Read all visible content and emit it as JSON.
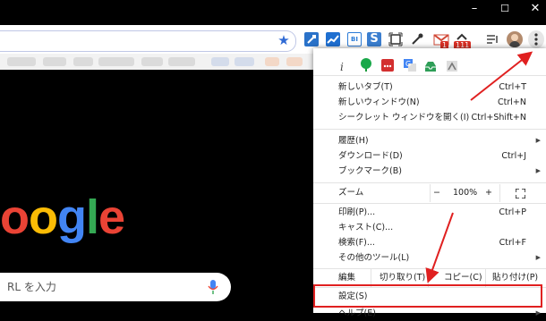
{
  "window": {
    "minimize": "–",
    "maximize": "☐",
    "close": "✕"
  },
  "toolbar": {
    "badge_mail": "1",
    "badge_cal": "111",
    "extensions": [
      "link-ext",
      "analytics-ext",
      "bi-ext",
      "s-ext",
      "capture-ext",
      "eyedropper-ext",
      "gmail-ext",
      "calendar-ext"
    ]
  },
  "logo_letters": [
    {
      "ch": "o",
      "color": "#ea4335"
    },
    {
      "ch": "o",
      "color": "#fbbc05"
    },
    {
      "ch": "g",
      "color": "#4285f4"
    },
    {
      "ch": "l",
      "color": "#34a853"
    },
    {
      "ch": "e",
      "color": "#ea4335"
    }
  ],
  "search": {
    "placeholder": "RL を入力"
  },
  "menu": {
    "new_tab": {
      "label": "新しいタブ(T)",
      "shortcut": "Ctrl+T"
    },
    "new_window": {
      "label": "新しいウィンドウ(N)",
      "shortcut": "Ctrl+N"
    },
    "incognito": {
      "label": "シークレット ウィンドウを開く(I)",
      "shortcut": "Ctrl+Shift+N"
    },
    "history": {
      "label": "履歴(H)"
    },
    "downloads": {
      "label": "ダウンロード(D)",
      "shortcut": "Ctrl+J"
    },
    "bookmarks": {
      "label": "ブックマーク(B)"
    },
    "zoom": {
      "label": "ズーム",
      "minus": "−",
      "value": "100%",
      "plus": "+"
    },
    "print": {
      "label": "印刷(P)...",
      "shortcut": "Ctrl+P"
    },
    "cast": {
      "label": "キャスト(C)..."
    },
    "find": {
      "label": "検索(F)...",
      "shortcut": "Ctrl+F"
    },
    "more_tools": {
      "label": "その他のツール(L)"
    },
    "edit": {
      "label": "編集",
      "cut": "切り取り(T)",
      "copy": "コピー(C)",
      "paste": "貼り付け(P)"
    },
    "settings": {
      "label": "設定(S)"
    },
    "help": {
      "label": "ヘルプ(E)"
    }
  },
  "colors": {
    "annotation": "#e02020",
    "star": "#2f6ad4"
  }
}
